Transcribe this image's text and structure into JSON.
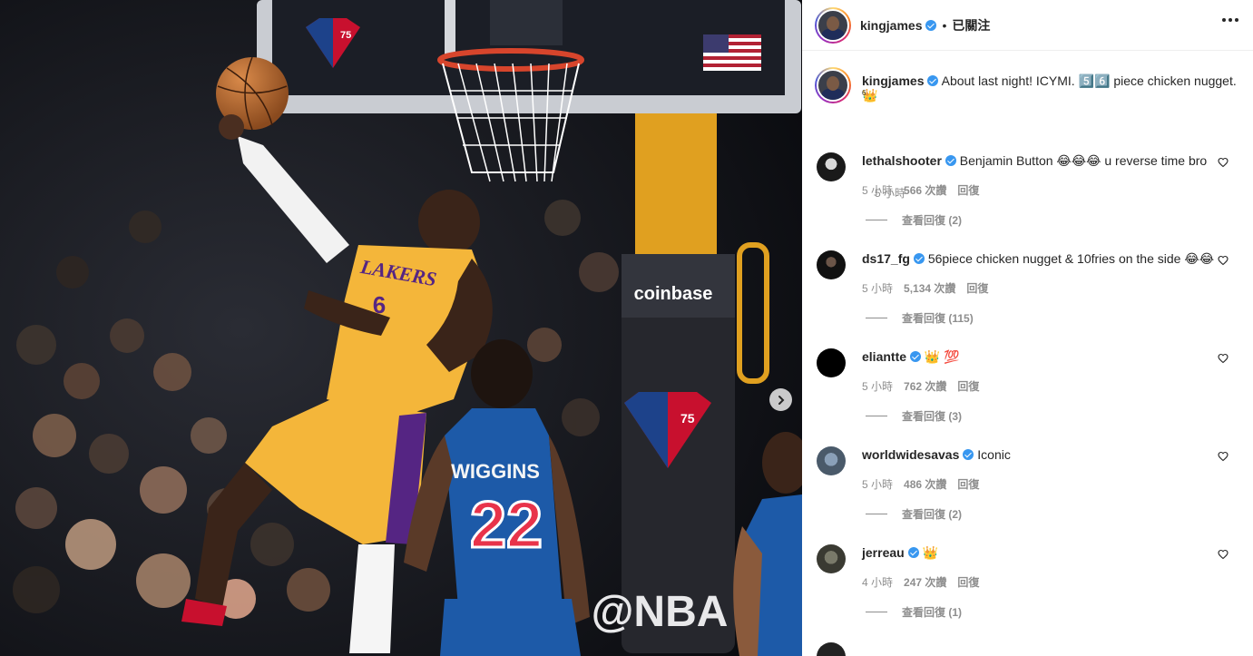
{
  "header": {
    "username": "kingjames",
    "separator": "•",
    "follow_status": "已關注"
  },
  "caption": {
    "username": "kingjames",
    "text": "About last night! ICYMI. 5️⃣6️⃣ piece chicken nugget. 👑",
    "sub": "6",
    "time": "5 小時"
  },
  "photo": {
    "jersey_name": "WIGGINS",
    "jersey_number": "22",
    "lakers_text": "LAKERS",
    "lakers_number": "6",
    "sponsor": "coinbase",
    "nba_tag": "@NBA",
    "logo_number": "75"
  },
  "comments": [
    {
      "username": "lethalshooter",
      "text": "Benjamin Button 😂😂😂 u reverse time bro",
      "time": "5 小時",
      "likes": "566 次讚",
      "reply": "回復",
      "view_replies": "查看回復 (2)"
    },
    {
      "username": "ds17_fg",
      "text": "56piece chicken nugget & 10fries on the side 😂😂",
      "time": "5 小時",
      "likes": "5,134 次讚",
      "reply": "回復",
      "view_replies": "查看回復 (115)"
    },
    {
      "username": "eliantte",
      "text": "👑 💯",
      "time": "5 小時",
      "likes": "762 次讚",
      "reply": "回復",
      "view_replies": "查看回復 (3)"
    },
    {
      "username": "worldwidesavas",
      "text": "Iconic",
      "time": "5 小時",
      "likes": "486 次讚",
      "reply": "回復",
      "view_replies": "查看回復 (2)"
    },
    {
      "username": "jerreau",
      "text": "👑",
      "time": "4 小時",
      "likes": "247 次讚",
      "reply": "回復",
      "view_replies": "查看回復 (1)"
    }
  ],
  "icons": {
    "next": "chevron-right-icon",
    "more": "more-options-icon",
    "like": "heart-icon",
    "verified": "verified-badge-icon"
  },
  "colors": {
    "verified_blue": "#3897f0",
    "secondary_text": "#8e8e8e",
    "lakers_gold": "#f4b63a",
    "warriors_blue": "#1d5aa8"
  }
}
